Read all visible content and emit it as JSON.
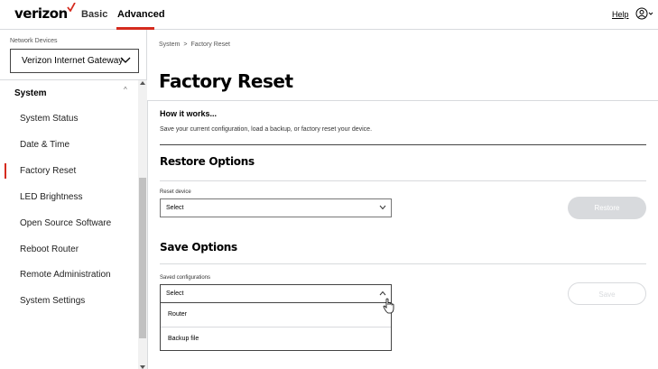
{
  "header": {
    "logo": "verizon",
    "tabs": [
      {
        "label": "Basic"
      },
      {
        "label": "Advanced"
      }
    ],
    "help": "Help",
    "accent_color": "#d52b1e"
  },
  "sidebar": {
    "network_devices_label": "Network Devices",
    "device_select_value": "Verizon Internet Gateway",
    "section": "System",
    "items": [
      {
        "label": "System Status"
      },
      {
        "label": "Date & Time"
      },
      {
        "label": "Factory Reset"
      },
      {
        "label": "LED Brightness"
      },
      {
        "label": "Open Source Software"
      },
      {
        "label": "Reboot Router"
      },
      {
        "label": "Remote Administration"
      },
      {
        "label": "System Settings"
      }
    ],
    "active_item": "Factory Reset"
  },
  "main": {
    "breadcrumb": [
      "System",
      "Factory Reset"
    ],
    "breadcrumb_sep": ">",
    "title": "Factory Reset",
    "how_it_works": {
      "title": "How it works...",
      "description": "Save your current configuration, load a backup, or factory reset your device."
    },
    "restore": {
      "title": "Restore Options",
      "field_label": "Reset device",
      "select_value": "Select",
      "button": "Restore"
    },
    "save": {
      "title": "Save Options",
      "field_label": "Saved configurations",
      "select_value": "Select",
      "options": [
        {
          "label": "Router"
        },
        {
          "label": "Backup file"
        }
      ],
      "button": "Save"
    }
  }
}
